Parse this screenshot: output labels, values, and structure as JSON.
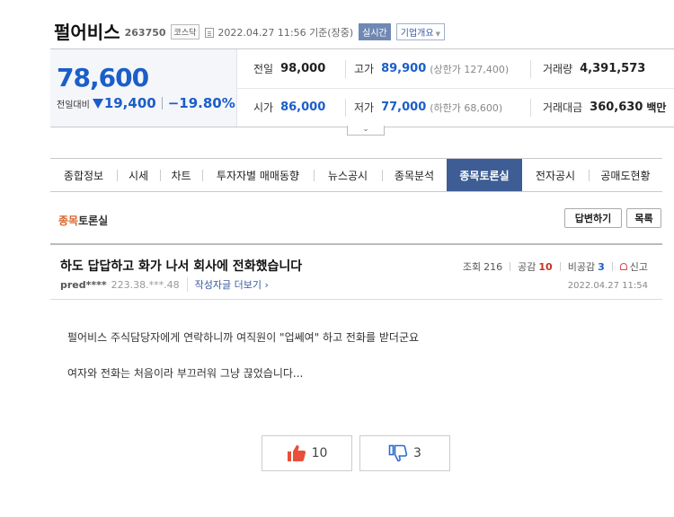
{
  "stock": {
    "name": "펄어비스",
    "code": "263750",
    "market_badge": "코스닥",
    "datetime": "2022.04.27 11:56 기준(장중)",
    "realtime_label": "실시간",
    "overview_label": "기업개요",
    "price": "78,600",
    "change_label": "전일대비",
    "change_value": "19,400",
    "change_rate": "−19.80%",
    "direction": "down",
    "color_up": "#c8321f",
    "color_down": "#1b5ec9"
  },
  "quotes": {
    "prev_close": {
      "label": "전일",
      "value": "98,000"
    },
    "high": {
      "label": "고가",
      "value": "89,900",
      "sub": "(상한가 127,400)"
    },
    "volume": {
      "label": "거래량",
      "value": "4,391,573"
    },
    "open": {
      "label": "시가",
      "value": "86,000"
    },
    "low": {
      "label": "저가",
      "value": "77,000",
      "sub": "(하한가 68,600)"
    },
    "trade_amount": {
      "label": "거래대금",
      "value": "360,630",
      "unit": "백만"
    }
  },
  "tabs": [
    {
      "label": "종합정보"
    },
    {
      "label": "시세"
    },
    {
      "label": "차트"
    },
    {
      "label": "투자자별 매매동향"
    },
    {
      "label": "뉴스공시"
    },
    {
      "label": "종목분석"
    },
    {
      "label": "종목토론실",
      "active": true
    },
    {
      "label": "전자공시"
    },
    {
      "label": "공매도현황"
    }
  ],
  "board": {
    "title_accent": "종목",
    "title_rest": "토론실",
    "reply_button": "답변하기",
    "list_button": "목록"
  },
  "post": {
    "title": "하도 답답하고 화가 나서 회사에 전화했습니다",
    "author": "pred****",
    "ip": "223.38.***.48",
    "more_posts": "작성자글 더보기 ›",
    "views_label": "조회",
    "views": "216",
    "likes_label": "공감",
    "likes": "10",
    "dislikes_label": "비공감",
    "dislikes": "3",
    "report_label": "신고",
    "time": "2022.04.27 11:54",
    "body": [
      "펄어비스 주식담당자에게 연락하니까 여직원이 \"업쎄여\" 하고 전화를 받더군요",
      "여자와 전화는 처음이라 부끄러워 그냥 끊었습니다..."
    ]
  },
  "votes": {
    "up_count": "10",
    "down_count": "3",
    "up_icon": "thumbs-up-icon",
    "down_icon": "thumbs-down-icon",
    "up_color": "#e8503a",
    "down_color": "#2c6bd1"
  }
}
